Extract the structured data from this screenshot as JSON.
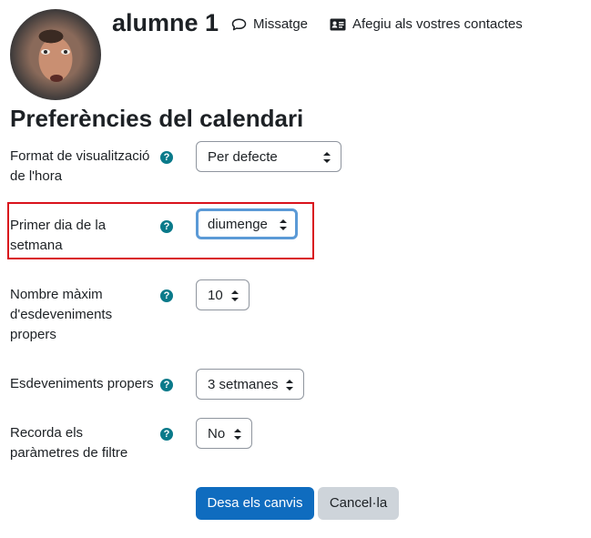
{
  "profile": {
    "name": "alumne 1",
    "message_label": "Missatge",
    "add_contact_label": "Afegiu als vostres contactes"
  },
  "page_title": "Preferències del calendari",
  "fields": [
    {
      "label": "Format de visualització de l'hora",
      "value": "Per defecte"
    },
    {
      "label": "Primer dia de la setmana",
      "value": "diumenge"
    },
    {
      "label": "Nombre màxim d'esdeveniments propers",
      "value": "10"
    },
    {
      "label": "Esdeveniments propers",
      "value": "3 setmanes"
    },
    {
      "label": "Recorda els paràmetres de filtre",
      "value": "No"
    }
  ],
  "help_glyph": "?",
  "buttons": {
    "save": "Desa els canvis",
    "cancel": "Cancel·la"
  },
  "colors": {
    "primary": "#0f6cbf",
    "help": "#0a7a8a",
    "highlight": "#d9121c",
    "focus": "#5b9ad6"
  },
  "icons": {
    "message": "chat-bubble-icon",
    "contact": "address-card-icon",
    "help": "question-circle-icon"
  }
}
